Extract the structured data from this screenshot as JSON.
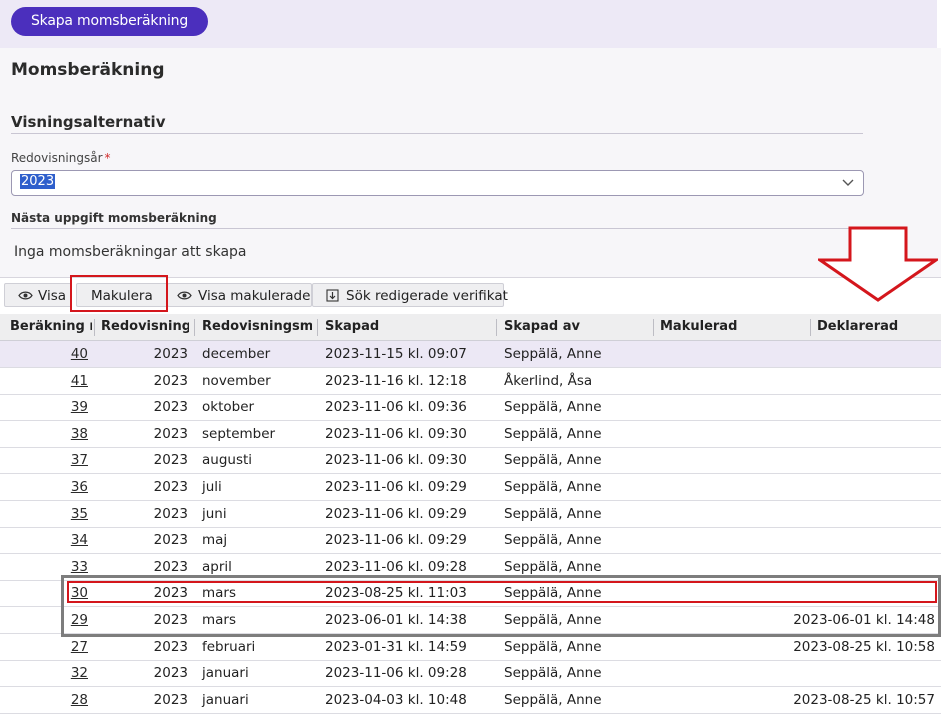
{
  "header": {
    "create_button": "Skapa momsberäkning"
  },
  "page": {
    "title": "Momsberäkning"
  },
  "view_options": {
    "title": "Visningsalternativ",
    "year_label": "Redovisningsår",
    "year_required_mark": "*",
    "year_value": "2023"
  },
  "next_task": {
    "title": "Nästa uppgift momsberäkning",
    "text": "Inga momsberäkningar att skapa"
  },
  "toolbar": {
    "view": "Visa",
    "void": "Makulera",
    "show_voided": "Visa makulerade",
    "search_edited": "Sök redigerade verifikat"
  },
  "table": {
    "columns": [
      "Beräkning nr",
      "Redovisningsår",
      "Redovisningsmånad",
      "Skapad",
      "Skapad av",
      "Makulerad",
      "Deklarerad"
    ],
    "rows": [
      {
        "nr": "40",
        "year": "2023",
        "month": "december",
        "created": "2023-11-15 kl. 09:07",
        "created_by": "Seppälä, Anne",
        "voided": "",
        "declared": ""
      },
      {
        "nr": "41",
        "year": "2023",
        "month": "november",
        "created": "2023-11-16 kl. 12:18",
        "created_by": "Åkerlind, Åsa",
        "voided": "",
        "declared": ""
      },
      {
        "nr": "39",
        "year": "2023",
        "month": "oktober",
        "created": "2023-11-06 kl. 09:36",
        "created_by": "Seppälä, Anne",
        "voided": "",
        "declared": ""
      },
      {
        "nr": "38",
        "year": "2023",
        "month": "september",
        "created": "2023-11-06 kl. 09:30",
        "created_by": "Seppälä, Anne",
        "voided": "",
        "declared": ""
      },
      {
        "nr": "37",
        "year": "2023",
        "month": "augusti",
        "created": "2023-11-06 kl. 09:30",
        "created_by": "Seppälä, Anne",
        "voided": "",
        "declared": ""
      },
      {
        "nr": "36",
        "year": "2023",
        "month": "juli",
        "created": "2023-11-06 kl. 09:29",
        "created_by": "Seppälä, Anne",
        "voided": "",
        "declared": ""
      },
      {
        "nr": "35",
        "year": "2023",
        "month": "juni",
        "created": "2023-11-06 kl. 09:29",
        "created_by": "Seppälä, Anne",
        "voided": "",
        "declared": ""
      },
      {
        "nr": "34",
        "year": "2023",
        "month": "maj",
        "created": "2023-11-06 kl. 09:29",
        "created_by": "Seppälä, Anne",
        "voided": "",
        "declared": ""
      },
      {
        "nr": "33",
        "year": "2023",
        "month": "april",
        "created": "2023-11-06 kl. 09:28",
        "created_by": "Seppälä, Anne",
        "voided": "",
        "declared": ""
      },
      {
        "nr": "30",
        "year": "2023",
        "month": "mars",
        "created": "2023-08-25 kl. 11:03",
        "created_by": "Seppälä, Anne",
        "voided": "",
        "declared": ""
      },
      {
        "nr": "29",
        "year": "2023",
        "month": "mars",
        "created": "2023-06-01 kl. 14:38",
        "created_by": "Seppälä, Anne",
        "voided": "",
        "declared": "2023-06-01 kl. 14:48"
      },
      {
        "nr": "27",
        "year": "2023",
        "month": "februari",
        "created": "2023-01-31 kl. 14:59",
        "created_by": "Seppälä, Anne",
        "voided": "",
        "declared": "2023-08-25 kl. 10:58"
      },
      {
        "nr": "32",
        "year": "2023",
        "month": "januari",
        "created": "2023-11-06 kl. 09:28",
        "created_by": "Seppälä, Anne",
        "voided": "",
        "declared": ""
      },
      {
        "nr": "28",
        "year": "2023",
        "month": "januari",
        "created": "2023-04-03 kl. 10:48",
        "created_by": "Seppälä, Anne",
        "voided": "",
        "declared": "2023-08-25 kl. 10:57"
      }
    ]
  },
  "colors": {
    "accent": "#4b2fbd",
    "annotation_red": "#d4161c",
    "annotation_grey": "#7d7d7d"
  },
  "icons": {
    "eye": "eye-icon",
    "download": "download-icon",
    "chevron": "chevron-down-icon",
    "arrow": "arrow-down-icon"
  }
}
